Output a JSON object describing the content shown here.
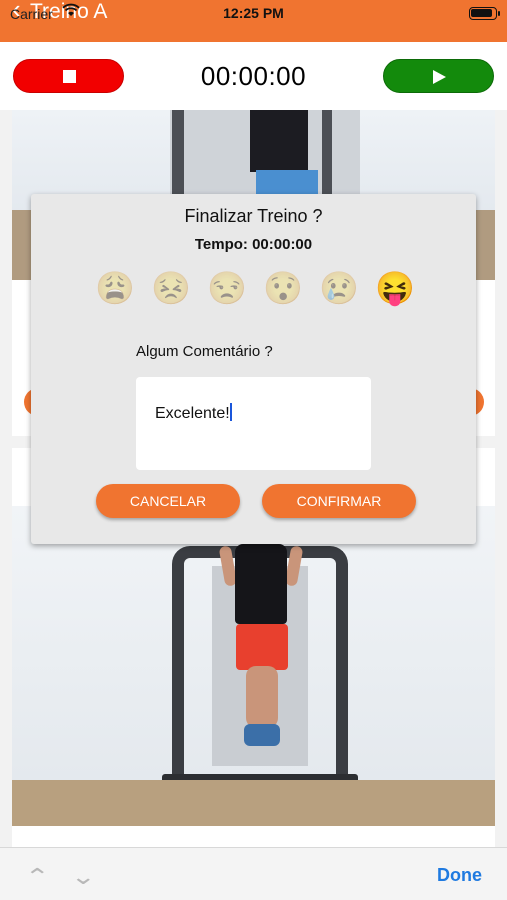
{
  "status_bar": {
    "carrier": "Carrier",
    "title": "Treino A",
    "time": "12:25 PM"
  },
  "timer": {
    "display": "00:00:00"
  },
  "modal": {
    "title": "Finalizar Treino ?",
    "time_label": "Tempo: 00:00:00",
    "moods": [
      "😩",
      "😣",
      "😒",
      "😯",
      "😢",
      "😝"
    ],
    "selected_mood_index": 5,
    "comment_label": "Algum Comentário ?",
    "comment_value": "Excelente!",
    "cancel_label": "CANCELAR",
    "confirm_label": "CONFIRMAR"
  },
  "keyboard_toolbar": {
    "up_icon": "⌃",
    "down_icon": "⌄",
    "done_label": "Done"
  },
  "colors": {
    "accent": "#f07430",
    "stop": "#f20000",
    "play": "#138a0c",
    "done": "#1f7ae0"
  }
}
